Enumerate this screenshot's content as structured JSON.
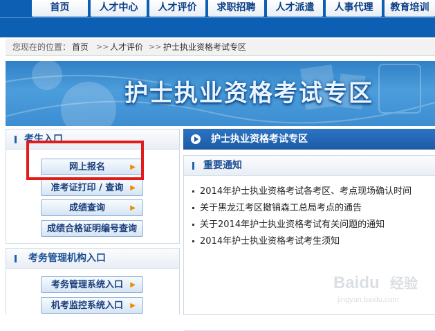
{
  "nav": {
    "items": [
      "首页",
      "人才中心",
      "人才评价",
      "求职招聘",
      "人才派遣",
      "人事代理",
      "教育培训"
    ]
  },
  "breadcrumb": {
    "prefix": "您现在的位置：",
    "items": [
      "首页",
      "人才评价",
      "护士执业资格考试专区"
    ],
    "separator": ">>"
  },
  "banner": {
    "title": "护士执业资格考试专区"
  },
  "left": {
    "candidate": {
      "title": "考生入口",
      "buttons": [
        "网上报名",
        "准考证打印 / 查询",
        "成绩查询",
        "成绩合格证明编号查询"
      ]
    },
    "admin": {
      "title": "考务管理机构入口",
      "buttons": [
        "考务管理系统入口",
        "机考监控系统入口"
      ]
    }
  },
  "right": {
    "header": "护士执业资格考试专区",
    "notice": {
      "title": "重要通知",
      "items": [
        "2014年护士执业资格考试各考区、考点现场确认时间",
        "关于黑龙江考区撤销森工总局考点的通告",
        "关于2014年护士执业资格考试有关问题的通知",
        "2014年护士执业资格考试考生须知"
      ]
    }
  },
  "watermark": {
    "brand": "Baidu",
    "text": "经验",
    "url": "jingyan.baidu.com"
  },
  "colors": {
    "nav_bg": "#0d5fb4",
    "accent": "#1c5aa6",
    "highlight": "#e21a1a",
    "arrow": "#f08a00"
  },
  "icons": {
    "arrow": "triangle-right-icon",
    "play": "play-circle-icon"
  }
}
